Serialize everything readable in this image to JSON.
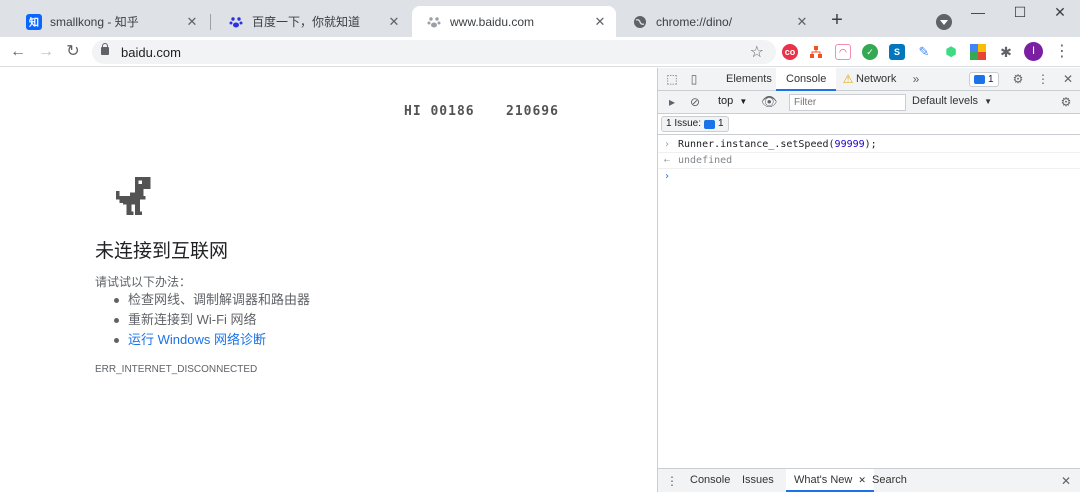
{
  "tabs": [
    {
      "title": "smallkong - 知乎",
      "favicon": "zhihu-icon",
      "color": "#0a66ff",
      "glyph": "知"
    },
    {
      "title": "百度一下，你就知道",
      "favicon": "baidu-paw-icon",
      "color": "#2932e1",
      "glyph": "🐾"
    },
    {
      "title": "www.baidu.com",
      "favicon": "baidu-paw-icon",
      "color": "#9aa0a6",
      "glyph": "🐾"
    },
    {
      "title": "chrome://dino/",
      "favicon": "globe-icon",
      "color": "#5f6368",
      "glyph": "🌐"
    }
  ],
  "window_controls": {
    "minimize": "—",
    "maximize": "☐",
    "close": "✕"
  },
  "toolbar": {
    "url": "baidu.com",
    "avatar_letter": "I"
  },
  "page": {
    "hi_score": "HI 00186",
    "score": "210696",
    "error_title": "未连接到互联网",
    "suggestion_intro": "请试试以下办法：",
    "suggestions": [
      "检查网线、调制解调器和路由器",
      "重新连接到 Wi-Fi 网络",
      "运行 Windows 网络诊断"
    ],
    "error_code": "ERR_INTERNET_DISCONNECTED"
  },
  "devtools": {
    "tabs": [
      "Elements",
      "Console",
      "Network"
    ],
    "more_tabs": "»",
    "issues_count": "1",
    "context": "top",
    "filter_placeholder": "Filter",
    "levels": "Default levels",
    "issues_label": "1 Issue:",
    "issues_chip_count": "1",
    "console": {
      "command_pre": "Runner.instance_.setSpeed(",
      "command_arg": "99999",
      "command_post": ");",
      "result": "undefined"
    },
    "drawer_tabs": [
      "Console",
      "Issues",
      "What's New",
      "Search"
    ]
  },
  "colors": {
    "accent": "#1a73e8",
    "dino": "#535353"
  }
}
